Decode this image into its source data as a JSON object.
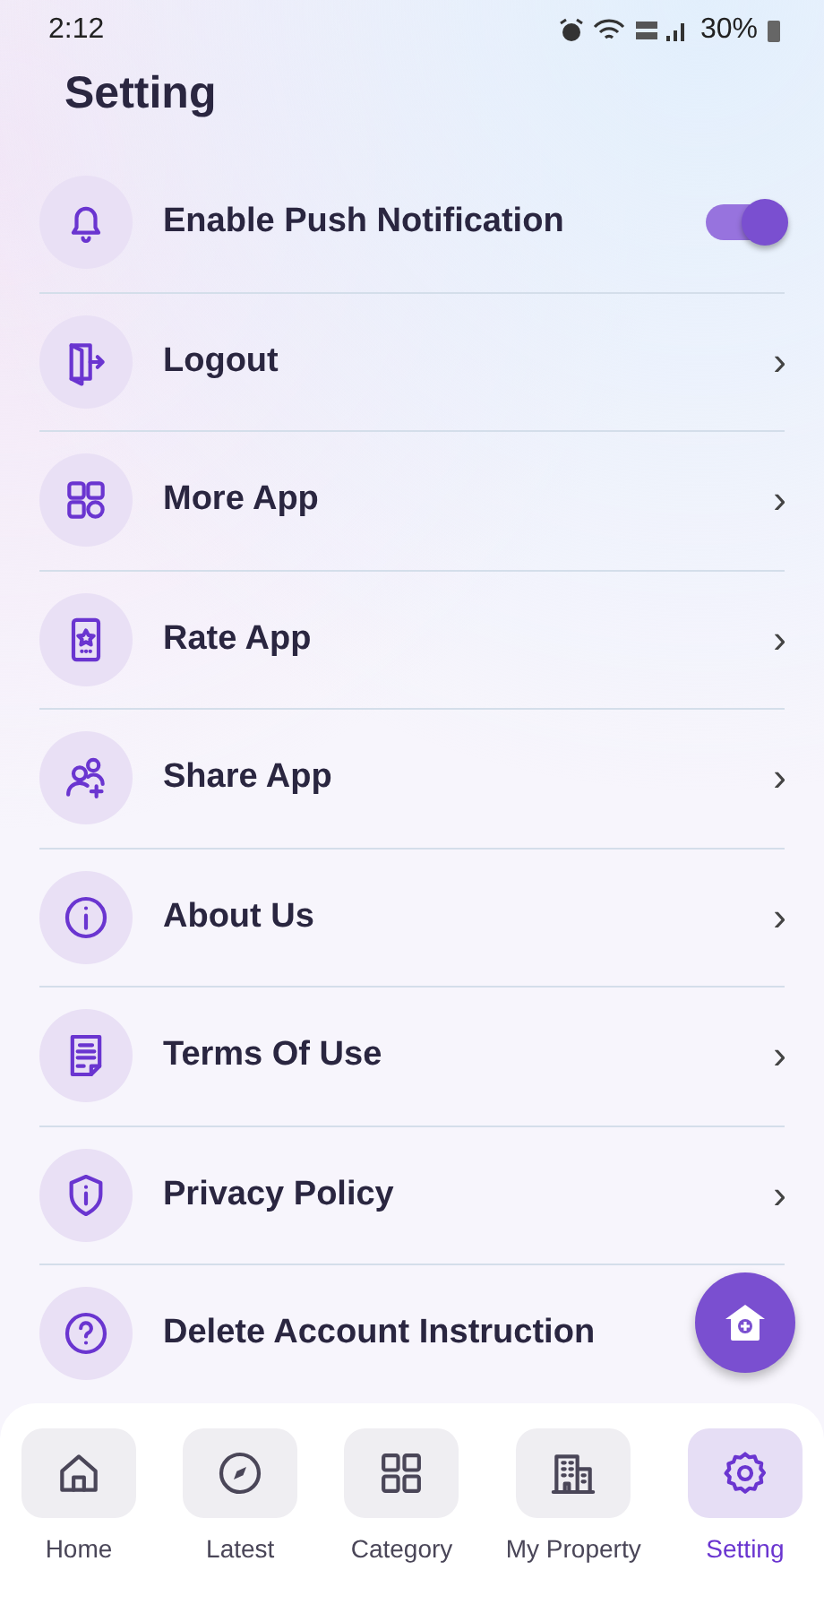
{
  "status_bar": {
    "time": "2:12",
    "battery": "30%"
  },
  "title": "Setting",
  "settings": [
    {
      "kind": "toggle",
      "label": "Enable Push Notification",
      "on": true
    },
    {
      "kind": "link",
      "label": "Logout",
      "chevron": "›"
    },
    {
      "kind": "link",
      "label": "More App",
      "chevron": "›"
    },
    {
      "kind": "link",
      "label": "Rate App",
      "chevron": "›"
    },
    {
      "kind": "link",
      "label": "Share App",
      "chevron": "›"
    },
    {
      "kind": "link",
      "label": "About Us",
      "chevron": "›"
    },
    {
      "kind": "link",
      "label": "Terms Of Use",
      "chevron": "›"
    },
    {
      "kind": "link",
      "label": "Privacy Policy",
      "chevron": "›"
    },
    {
      "kind": "link",
      "label": "Delete Account Instruction"
    }
  ],
  "bottom_nav": [
    {
      "label": "Home",
      "selected": false
    },
    {
      "label": "Latest",
      "selected": false
    },
    {
      "label": "Category",
      "selected": false
    },
    {
      "label": "My Property",
      "selected": false
    },
    {
      "label": "Setting",
      "selected": true
    }
  ]
}
